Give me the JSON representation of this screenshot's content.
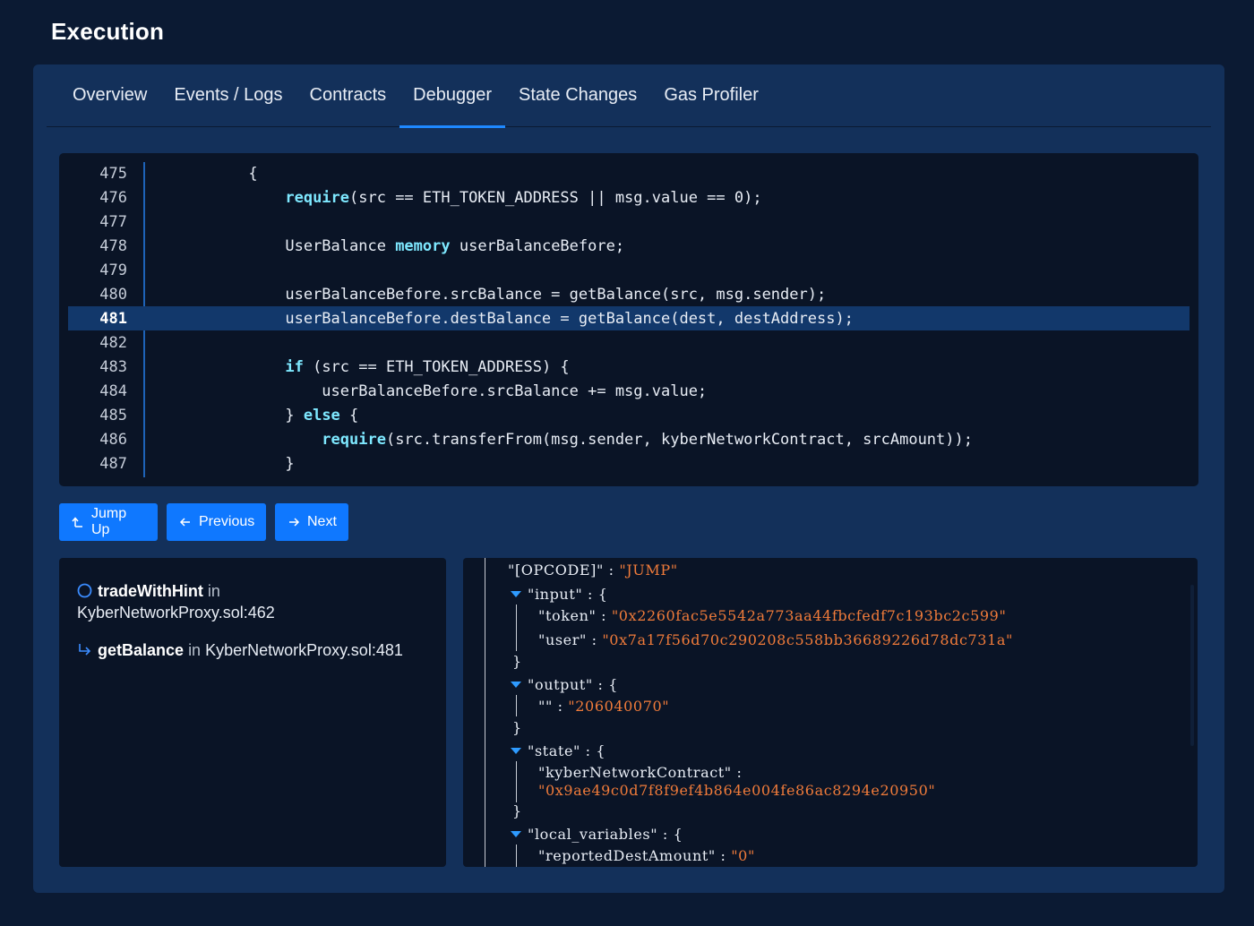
{
  "page": {
    "title": "Execution"
  },
  "tabs": [
    {
      "label": "Overview"
    },
    {
      "label": "Events / Logs"
    },
    {
      "label": "Contracts"
    },
    {
      "label": "Debugger",
      "active": true
    },
    {
      "label": "State Changes"
    },
    {
      "label": "Gas Profiler"
    }
  ],
  "code": {
    "highlight_line": "481",
    "lines": [
      {
        "n": "475",
        "indent": "      ",
        "parts": [
          [
            "t",
            "{"
          ]
        ]
      },
      {
        "n": "476",
        "indent": "          ",
        "parts": [
          [
            "k",
            "require"
          ],
          [
            "t",
            "(src == ETH_TOKEN_ADDRESS || msg.value == 0);"
          ]
        ]
      },
      {
        "n": "477",
        "indent": "",
        "parts": []
      },
      {
        "n": "478",
        "indent": "          ",
        "parts": [
          [
            "t",
            "UserBalance "
          ],
          [
            "k",
            "memory"
          ],
          [
            "t",
            " userBalanceBefore;"
          ]
        ]
      },
      {
        "n": "479",
        "indent": "",
        "parts": []
      },
      {
        "n": "480",
        "indent": "          ",
        "parts": [
          [
            "t",
            "userBalanceBefore.srcBalance = getBalance(src, msg.sender);"
          ]
        ]
      },
      {
        "n": "481",
        "indent": "          ",
        "parts": [
          [
            "t",
            "userBalanceBefore.destBalance = getBalance(dest, destAddress);"
          ]
        ]
      },
      {
        "n": "482",
        "indent": "",
        "parts": []
      },
      {
        "n": "483",
        "indent": "          ",
        "parts": [
          [
            "k",
            "if"
          ],
          [
            "t",
            " (src == ETH_TOKEN_ADDRESS) {"
          ]
        ]
      },
      {
        "n": "484",
        "indent": "              ",
        "parts": [
          [
            "t",
            "userBalanceBefore.srcBalance += msg.value;"
          ]
        ]
      },
      {
        "n": "485",
        "indent": "          ",
        "parts": [
          [
            "t",
            "} "
          ],
          [
            "k",
            "else"
          ],
          [
            "t",
            " {"
          ]
        ]
      },
      {
        "n": "486",
        "indent": "              ",
        "parts": [
          [
            "k",
            "require"
          ],
          [
            "t",
            "(src.transferFrom(msg.sender, kyberNetworkContract, srcAmount));"
          ]
        ]
      },
      {
        "n": "487",
        "indent": "          ",
        "parts": [
          [
            "t",
            "}"
          ]
        ]
      }
    ]
  },
  "buttons": {
    "jump_up": "Jump Up",
    "previous": "Previous",
    "next": "Next"
  },
  "stack": {
    "frames": [
      {
        "fn": "tradeWithHint",
        "in": "in",
        "location": "KyberNetworkProxy.sol:462",
        "icon": "circle-icon"
      },
      {
        "fn": "getBalance",
        "in": "in",
        "location": "KyberNetworkProxy.sol:481",
        "icon": "return-arrow-icon"
      }
    ]
  },
  "json_view": {
    "opcode_key": "\"[OPCODE]\"",
    "opcode_value": "\"JUMP\"",
    "input_key": "\"input\"",
    "token_key": "\"token\"",
    "token_value": "\"0x2260fac5e5542a773aa44fbcfedf7c193bc2c599\"",
    "user_key": "\"user\"",
    "user_value": "\"0x7a17f56d70c290208c558bb36689226d78dc731a\"",
    "output_key": "\"output\"",
    "output_sub_key": "\"\"",
    "output_value": "\"206040070\"",
    "state_key": "\"state\"",
    "kyber_key": "\"kyberNetworkContract\"",
    "kyber_value": "\"0x9ae49c0d7f8f9ef4b864e004fe86ac8294e20950\"",
    "locals_key": "\"local_variables\"",
    "reported_key": "\"reportedDestAmount\"",
    "reported_value": "\"0\""
  },
  "colors": {
    "accent": "#1e88ff",
    "button": "#0f78ff",
    "keyword": "#7ee8ff",
    "string": "#f07b3a"
  }
}
